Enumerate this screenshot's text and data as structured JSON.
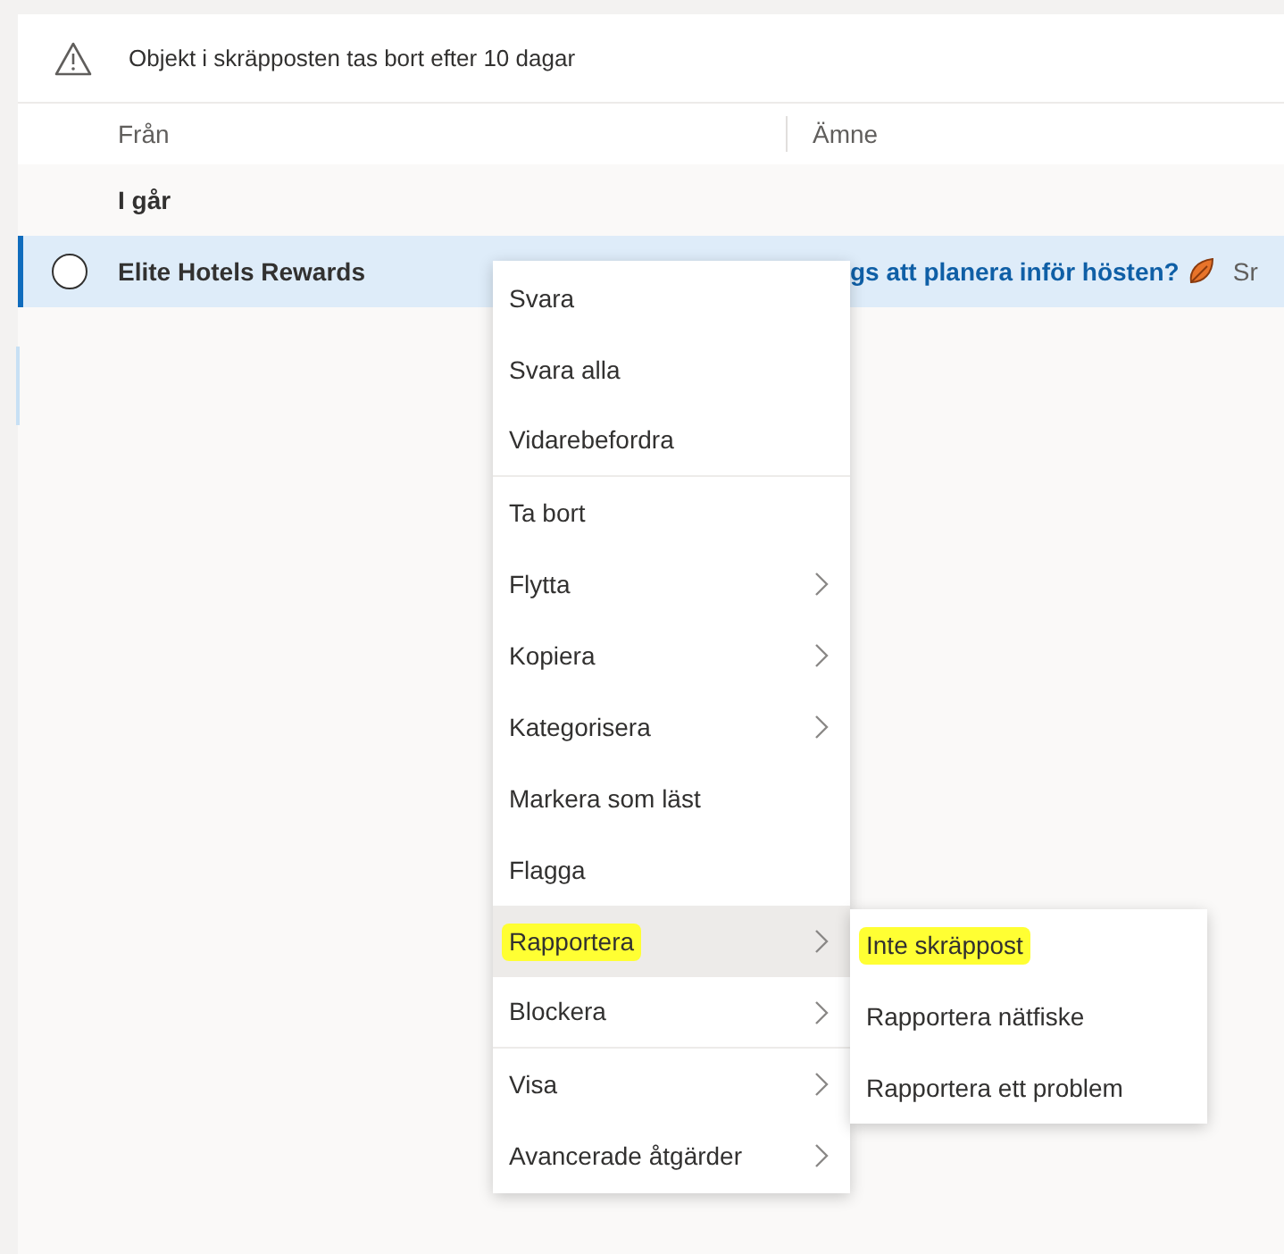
{
  "notice": {
    "text": "Objekt i skräpposten tas bort efter 10 dagar"
  },
  "columns": [
    "Från",
    "Ämne"
  ],
  "group": {
    "label": "I går"
  },
  "message": {
    "sender": "Elite Hotels Rewards",
    "subject": "gs att planera inför hösten?",
    "preview": "Sr",
    "selected": true
  },
  "menu": {
    "items": [
      {
        "label": "Svara",
        "submenu": false,
        "highlighted": false,
        "selected": false,
        "separator_after": false
      },
      {
        "label": "Svara alla",
        "submenu": false,
        "highlighted": false,
        "selected": false,
        "separator_after": false
      },
      {
        "label": "Vidarebefordra",
        "submenu": false,
        "highlighted": false,
        "selected": false,
        "separator_after": true
      },
      {
        "label": "Ta bort",
        "submenu": false,
        "highlighted": false,
        "selected": false,
        "separator_after": false
      },
      {
        "label": "Flytta",
        "submenu": true,
        "highlighted": false,
        "selected": false,
        "separator_after": false
      },
      {
        "label": "Kopiera",
        "submenu": true,
        "highlighted": false,
        "selected": false,
        "separator_after": false
      },
      {
        "label": "Kategorisera",
        "submenu": true,
        "highlighted": false,
        "selected": false,
        "separator_after": false
      },
      {
        "label": "Markera som läst",
        "submenu": false,
        "highlighted": false,
        "selected": false,
        "separator_after": false
      },
      {
        "label": "Flagga",
        "submenu": false,
        "highlighted": false,
        "selected": false,
        "separator_after": false
      },
      {
        "label": "Rapportera",
        "submenu": true,
        "highlighted": true,
        "selected": true,
        "separator_after": false
      },
      {
        "label": "Blockera",
        "submenu": true,
        "highlighted": false,
        "selected": false,
        "separator_after": true
      },
      {
        "label": "Visa",
        "submenu": true,
        "highlighted": false,
        "selected": false,
        "separator_after": false
      },
      {
        "label": "Avancerade åtgärder",
        "submenu": true,
        "highlighted": false,
        "selected": false,
        "separator_after": false
      }
    ]
  },
  "submenu": {
    "items": [
      {
        "label": "Inte skräppost",
        "highlighted": true
      },
      {
        "label": "Rapportera nätfiske",
        "highlighted": false
      },
      {
        "label": "Rapportera ett problem",
        "highlighted": false
      }
    ]
  }
}
